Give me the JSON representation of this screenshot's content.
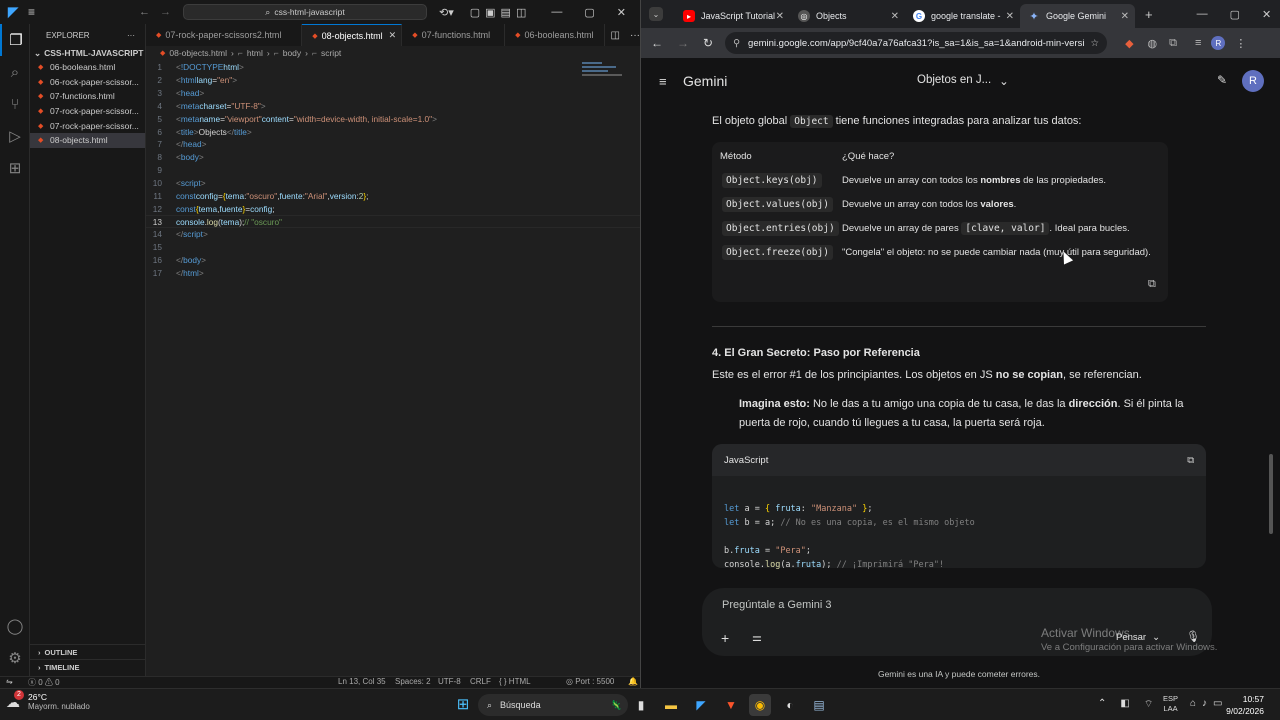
{
  "vscode": {
    "search": "css-html-javascript",
    "explorer_title": "EXPLORER",
    "folder": "CSS-HTML-JAVASCRIPT",
    "files": [
      "06-booleans.html",
      "06-rock-paper-scissor...",
      "07-functions.html",
      "07-rock-paper-scissor...",
      "07-rock-paper-scissor...",
      "08-objects.html"
    ],
    "selected_file": "08-objects.html",
    "outline": "OUTLINE",
    "timeline": "TIMELINE",
    "tabs": [
      "07-rock-paper-scissors2.html",
      "08-objects.html",
      "07-functions.html",
      "06-booleans.html"
    ],
    "active_tab": "08-objects.html",
    "breadcrumb": [
      "08-objects.html",
      "html",
      "body",
      "script"
    ],
    "status": {
      "errors": "0",
      "warnings": "0",
      "position": "Ln 13, Col 35",
      "spaces": "Spaces: 2",
      "encoding": "UTF-8",
      "eol": "CRLF",
      "lang": "HTML",
      "port": "Port : 5500"
    }
  },
  "chrome": {
    "tabs": [
      "JavaScript Tutorial",
      "Objects",
      "google translate -",
      "Google Gemini"
    ],
    "active_tab": "Google Gemini",
    "url": "gemini.google.com/app/9cf40a7a76afca31?is_sa=1&is_sa=1&android-min-versi..."
  },
  "gemini": {
    "brand": "Gemini",
    "conv_title": "Objetos en J...",
    "avatar": "R",
    "intro_a": "El objeto global ",
    "intro_code": "Object",
    "intro_b": " tiene funciones integradas para analizar tus datos:",
    "col1": "Método",
    "col2": "¿Qué hace?",
    "rows": [
      {
        "m": "Object.keys(obj)",
        "a": "Devuelve un array con todos los ",
        "b": "nombres",
        "c": " de las propiedades."
      },
      {
        "m": "Object.values(obj)",
        "a": "Devuelve un array con todos los ",
        "b": "valores",
        "c": "."
      },
      {
        "m": "Object.entries(obj)",
        "a": "Devuelve un array de pares ",
        "code": "[clave, valor]",
        "c": ". Ideal para bucles."
      },
      {
        "m": "Object.freeze(obj)",
        "a": "\"Congela\" el objeto: no se puede cambiar nada (muy útil para seguridad).",
        "b": "",
        "c": ""
      }
    ],
    "heading": "4. El Gran Secreto: Paso por Referencia",
    "p1a": "Este es el error #1 de los principiantes. Los objetos en JS ",
    "p1b": "no se copian",
    "p1c": ", se referencian.",
    "q_a": "Imagina esto:",
    "q_b": " No le das a tu amigo una copia de tu casa, le das la ",
    "q_c": "dirección",
    "q_d": ". Si él pinta la puerta de rojo, cuando tú llegues a tu casa, la puerta será roja.",
    "code_lang": "JavaScript",
    "input_placeholder": "Pregúntale a Gemini 3",
    "think": "Pensar",
    "footer": "Gemini es una IA y puede cometer errores.",
    "watermark1": "Activar Windows",
    "watermark2": "Ve a Configuración para activar Windows."
  },
  "taskbar": {
    "temp": "26°C",
    "weather": "Mayorm. nublado",
    "badge": "2",
    "search": "Búsqueda",
    "lang1": "ESP",
    "lang2": "LAA",
    "time": "10:57",
    "date": "9/02/2026"
  }
}
